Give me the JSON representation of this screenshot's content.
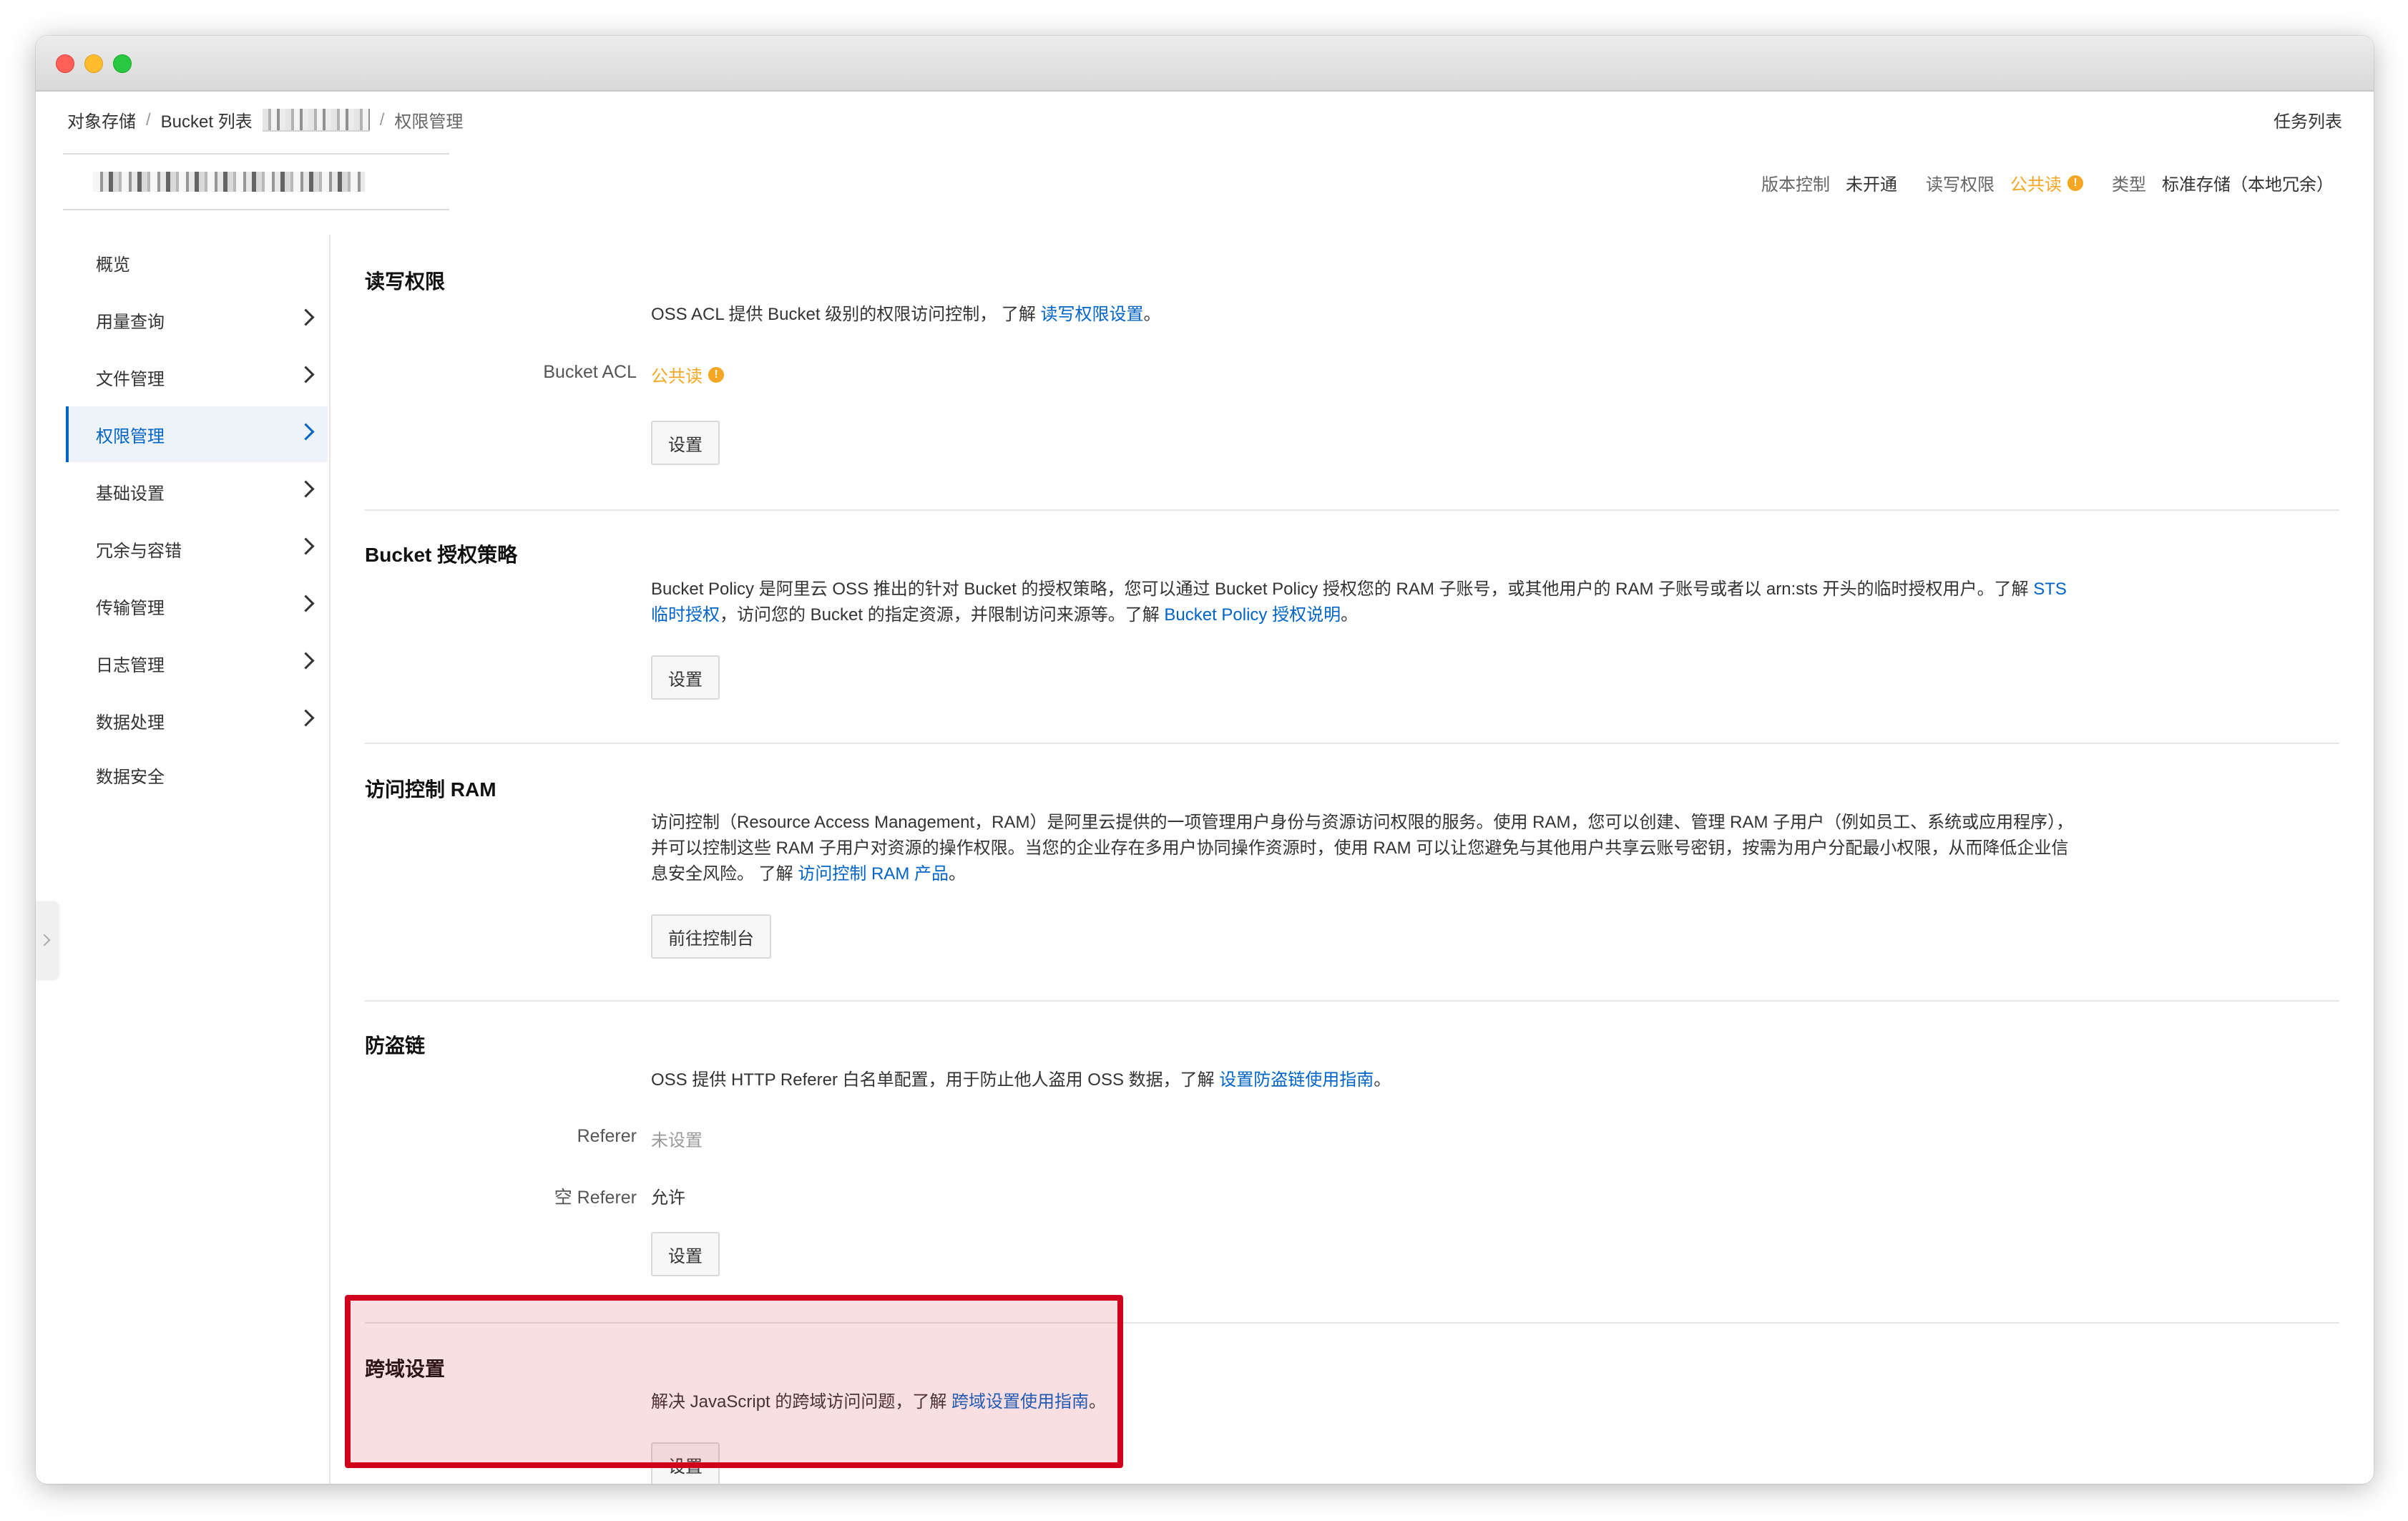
{
  "breadcrumb": {
    "root": "对象存储",
    "list": "Bucket 列表",
    "current": "权限管理",
    "separator": "/"
  },
  "header": {
    "task_list": "任务列表"
  },
  "bucket_info": {
    "version_label": "版本控制",
    "version_value": "未开通",
    "rw_label": "读写权限",
    "rw_value": "公共读",
    "type_label": "类型",
    "type_value": "标准存储（本地冗余）"
  },
  "sidebar": {
    "items": [
      {
        "label": "概览",
        "has_arrow": false
      },
      {
        "label": "用量查询",
        "has_arrow": true
      },
      {
        "label": "文件管理",
        "has_arrow": true
      },
      {
        "label": "权限管理",
        "has_arrow": true,
        "active": true
      },
      {
        "label": "基础设置",
        "has_arrow": true
      },
      {
        "label": "冗余与容错",
        "has_arrow": true
      },
      {
        "label": "传输管理",
        "has_arrow": true
      },
      {
        "label": "日志管理",
        "has_arrow": true
      },
      {
        "label": "数据处理",
        "has_arrow": true
      },
      {
        "label": "数据安全",
        "has_arrow": false
      }
    ]
  },
  "sections": {
    "acl": {
      "title": "读写权限",
      "desc_text": "OSS ACL 提供 Bucket 级别的权限访问控制， 了解 ",
      "desc_link": "读写权限设置",
      "desc_end": "。",
      "field_label": "Bucket ACL",
      "field_value": "公共读",
      "button": "设置"
    },
    "policy": {
      "title": "Bucket 授权策略",
      "desc_text1": "Bucket Policy 是阿里云 OSS 推出的针对 Bucket 的授权策略，您可以通过 Bucket Policy 授权您的 RAM 子账号，或其他用户的 RAM 子账号或者以 arn:sts 开头的临时授权用户。了解 ",
      "desc_link1": "STS 临时授权",
      "desc_text2": "，访问您的 Bucket 的指定资源，并限制访问来源等。了解 ",
      "desc_link2": "Bucket Policy 授权说明",
      "desc_end": "。",
      "button": "设置"
    },
    "ram": {
      "title": "访问控制 RAM",
      "desc_text": "访问控制（Resource Access Management，RAM）是阿里云提供的一项管理用户身份与资源访问权限的服务。使用 RAM，您可以创建、管理 RAM 子用户（例如员工、系统或应用程序），并可以控制这些 RAM 子用户对资源的操作权限。当您的企业存在多用户协同操作资源时，使用 RAM 可以让您避免与其他用户共享云账号密钥，按需为用户分配最小权限，从而降低企业信息安全风险。 了解 ",
      "desc_link": "访问控制 RAM 产品",
      "desc_end": "。",
      "button": "前往控制台"
    },
    "referer": {
      "title": "防盗链",
      "desc_text": "OSS 提供 HTTP Referer 白名单配置，用于防止他人盗用 OSS 数据，了解 ",
      "desc_link": "设置防盗链使用指南",
      "desc_end": "。",
      "referer_label": "Referer",
      "referer_value": "未设置",
      "empty_label": "空 Referer",
      "empty_value": "允许",
      "button": "设置"
    },
    "cors": {
      "title": "跨域设置",
      "desc_text": "解决 JavaScript 的跨域访问问题，了解 ",
      "desc_link": "跨域设置使用指南",
      "desc_end": "。",
      "button": "设置"
    }
  },
  "colors": {
    "accent": "#0064c8",
    "warning": "#f5a623",
    "highlight_border": "#d0021b"
  }
}
